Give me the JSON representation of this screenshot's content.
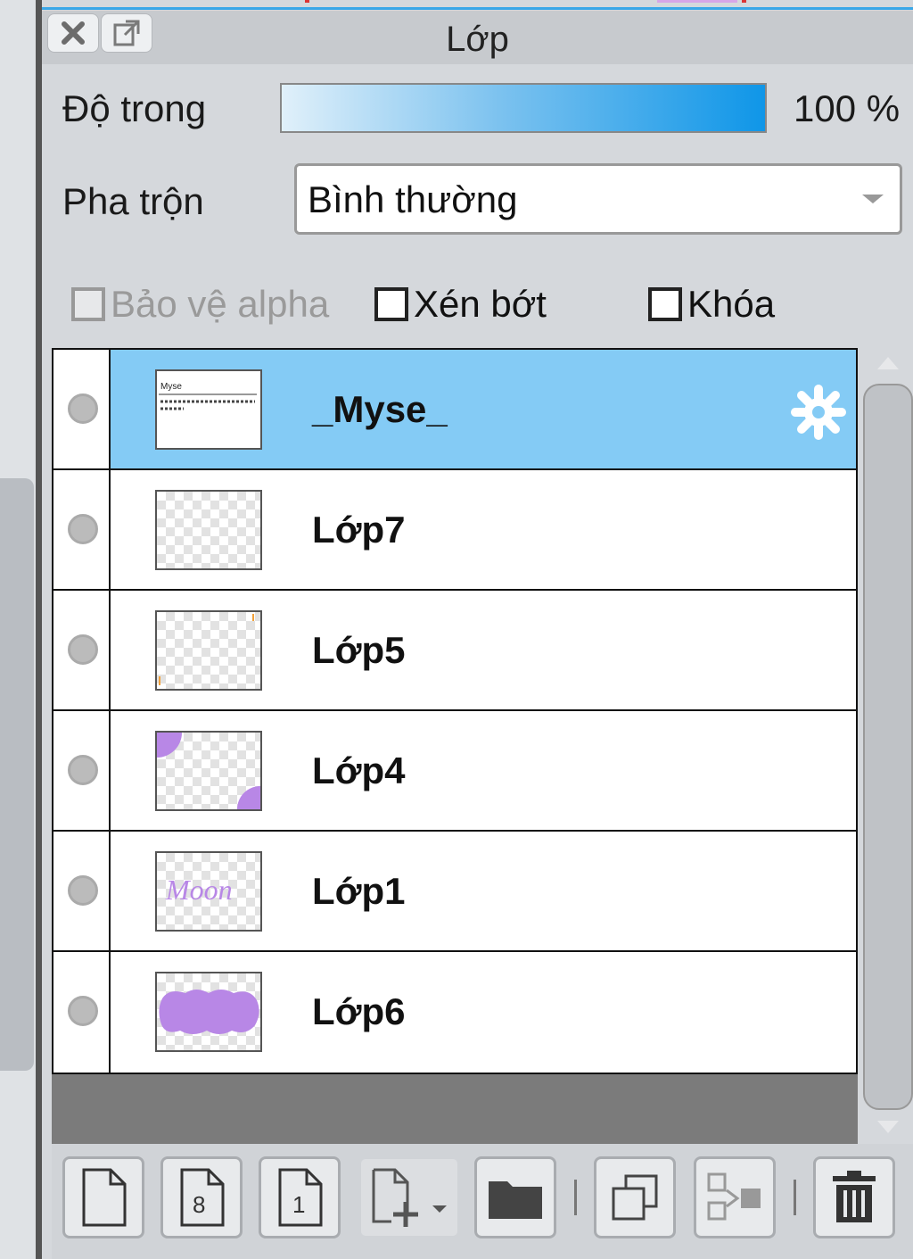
{
  "panel": {
    "title": "Lớp"
  },
  "titlebar": {
    "close_icon": "close-icon",
    "detach_icon": "detach-window-icon"
  },
  "opacity": {
    "label": "Độ trong",
    "value_text": "100 %",
    "value": 1.0
  },
  "blend": {
    "label": "Pha trộn",
    "selected": "Bình thường"
  },
  "checks": {
    "protect_alpha": {
      "label": "Bảo vệ alpha",
      "checked": false,
      "disabled": true
    },
    "clipping": {
      "label": "Xén bớt",
      "checked": false
    },
    "lock": {
      "label": "Khóa",
      "checked": false
    }
  },
  "layers": [
    {
      "name": "_Myse_",
      "selected": true,
      "thumb": "text",
      "visible_icon": "visibility-dot-icon",
      "settings_icon": "gear-icon"
    },
    {
      "name": "Lớp7",
      "selected": false,
      "thumb": "empty"
    },
    {
      "name": "Lớp5",
      "selected": false,
      "thumb": "empty"
    },
    {
      "name": "Lớp4",
      "selected": false,
      "thumb": "corners"
    },
    {
      "name": "Lớp1",
      "selected": false,
      "thumb": "script"
    },
    {
      "name": "Lớp6",
      "selected": false,
      "thumb": "blob"
    }
  ],
  "thumb_text": {
    "myse": "Myse",
    "script": "Moon"
  },
  "toolbar": {
    "buttons": [
      "new-layer-icon",
      "new-8bit-layer-icon",
      "new-1bit-layer-icon",
      "new-layer-menu-icon",
      "folder-icon",
      "duplicate-layer-icon",
      "merge-down-icon",
      "trash-icon"
    ],
    "badge_8": "8",
    "badge_1": "1"
  },
  "colors": {
    "accent": "#0f96e8",
    "selection": "#84cbf5",
    "purple": "#b887e6"
  }
}
